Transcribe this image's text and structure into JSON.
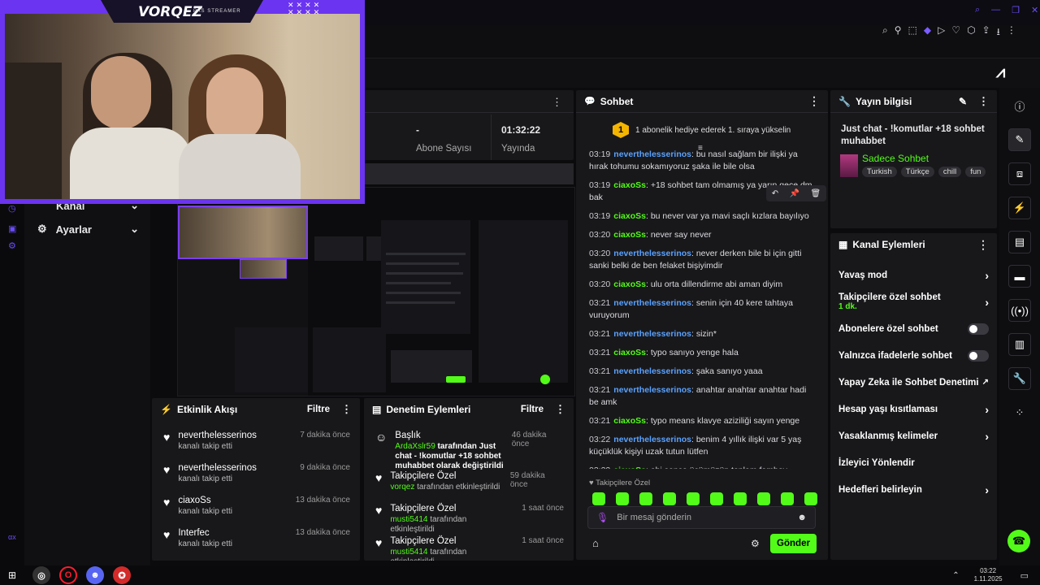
{
  "top": {
    "brand": "VORQEZ",
    "brand_sub": "PAS STREAMER"
  },
  "stats": {
    "value1": "-",
    "label1": "Abone Sayısı",
    "value2": "01:32:22",
    "label2": "Yayında"
  },
  "sidebar": {
    "kanal": "Kanal",
    "ayarlar": "Ayarlar",
    "fx": "αx"
  },
  "chat": {
    "title": "Sohbet",
    "pinned_badge": "1",
    "pinned": "1 abonelik hediye ederek 1. sıraya yükselin",
    "lines": [
      {
        "time": "03:19",
        "user": "neverthelesserinos",
        "color": "blue",
        "text": "bu nasıl sağlam bir ilişki ya hırak tohumu sokamıyoruz şaka ile bile olsa"
      },
      {
        "time": "03:19",
        "user": "ciaxoSs",
        "color": "green",
        "text": "+18 sohbet tam olmamış ya yarın gece dm bak"
      },
      {
        "time": "03:19",
        "user": "ciaxoSs",
        "color": "green",
        "text": "bu never var ya mavi saçlı kızlara bayılıyo"
      },
      {
        "time": "03:20",
        "user": "ciaxoSs",
        "color": "green",
        "text": "never say never"
      },
      {
        "time": "03:20",
        "user": "neverthelesserinos",
        "color": "blue",
        "text": "never derken bile bi için gitti sanki belki de ben felaket bişiyimdir"
      },
      {
        "time": "03:20",
        "user": "ciaxoSs",
        "color": "green",
        "text": "ulu orta dillendirme abi aman diyim"
      },
      {
        "time": "03:21",
        "user": "neverthelesserinos",
        "color": "blue",
        "text": "senin için 40 kere tahtaya vuruyorum"
      },
      {
        "time": "03:21",
        "user": "neverthelesserinos",
        "color": "blue",
        "text": "sizin*"
      },
      {
        "time": "03:21",
        "user": "ciaxoSs",
        "color": "green",
        "text": "typo sanıyo yenge hala"
      },
      {
        "time": "03:21",
        "user": "neverthelesserinos",
        "color": "blue",
        "text": "şaka sanıyo yaaa"
      },
      {
        "time": "03:21",
        "user": "neverthelesserinos",
        "color": "blue",
        "text": "anahtar anahtar anahtar hadi be amk"
      },
      {
        "time": "03:21",
        "user": "ciaxoSs",
        "color": "green",
        "text": "typo means klavye aziziliği sayın yenge"
      },
      {
        "time": "03:22",
        "user": "neverthelesserinos",
        "color": "blue",
        "text": "benim 4 yıllık ilişki var 5 yaş küçüklük kişiyi uzak tutun lütfen"
      },
      {
        "time": "03:22",
        "user": "ciaxoSs",
        "color": "green",
        "text": "abi sence üçümüzün toplam femboy deneyimi sayısı kaçtır sen ben never'ın"
      }
    ],
    "emote_header": "Takipçilere Özel",
    "input_placeholder": "Bir mesaj gönderin",
    "send": "Gönder"
  },
  "info": {
    "title": "Yayın bilgisi",
    "stream_title": "Just chat - !komutlar +18 sohbet muhabbet",
    "category": "Sadece Sohbet",
    "tags": [
      "Turkish",
      "Türkçe",
      "chill",
      "fun"
    ]
  },
  "channel_actions": {
    "title": "Kanal Eylemleri",
    "rows": [
      {
        "label": "Yavaş mod",
        "sub": "",
        "right": "chevron"
      },
      {
        "label": "Takipçilere özel sohbet",
        "sub": "1 dk.",
        "right": "chevron"
      },
      {
        "label": "Abonelere özel sohbet",
        "sub": "",
        "right": "toggle"
      },
      {
        "label": "Yalnızca ifadelerle sohbet",
        "sub": "",
        "right": "toggle"
      },
      {
        "label": "Yapay Zeka ile Sohbet Denetimi",
        "sub": "",
        "right": "external"
      },
      {
        "label": "Hesap yaşı kısıtlaması",
        "sub": "",
        "right": "chevron"
      },
      {
        "label": "Yasaklanmış kelimeler",
        "sub": "",
        "right": "chevron"
      },
      {
        "label": "İzleyici Yönlendir",
        "sub": "",
        "right": ""
      },
      {
        "label": "Hedefleri belirleyin",
        "sub": "",
        "right": "chevron"
      }
    ]
  },
  "activity": {
    "title": "Etkinlik Akışı",
    "filter": "Filtre",
    "items": [
      {
        "name": "neverthelesserinos",
        "sub": "kanalı takip etti",
        "time": "7 dakika önce"
      },
      {
        "name": "neverthelesserinos",
        "sub": "kanalı takip etti",
        "time": "9 dakika önce"
      },
      {
        "name": "ciaxoSs",
        "sub": "kanalı takip etti",
        "time": "13 dakika önce"
      },
      {
        "name": "Interfec",
        "sub": "kanalı takip etti",
        "time": "13 dakika önce"
      }
    ]
  },
  "moderation": {
    "title": "Denetim Eylemleri",
    "filter": "Filtre",
    "items": [
      {
        "title": "Başlık",
        "time": "46 dakika önce",
        "user": "ArdaXslr59",
        "text": " tarafından Just chat - !komutlar +18 sohbet muhabbet olarak değiştirildi"
      },
      {
        "title": "Takipçilere Özel",
        "time": "59 dakika önce",
        "user": "vorqez",
        "text": " tarafından etkinleştirildi"
      },
      {
        "title": "Takipçilere Özel",
        "time": "1 saat önce",
        "user": "musti5414",
        "text": " tarafından etkinleştirildi"
      },
      {
        "title": "Takipçilere Özel",
        "time": "1 saat önce",
        "user": "musti5414",
        "text": " tarafından etkinleştirildi"
      }
    ]
  },
  "taskbar": {
    "time": "03:22",
    "date": "1.11.2025"
  }
}
